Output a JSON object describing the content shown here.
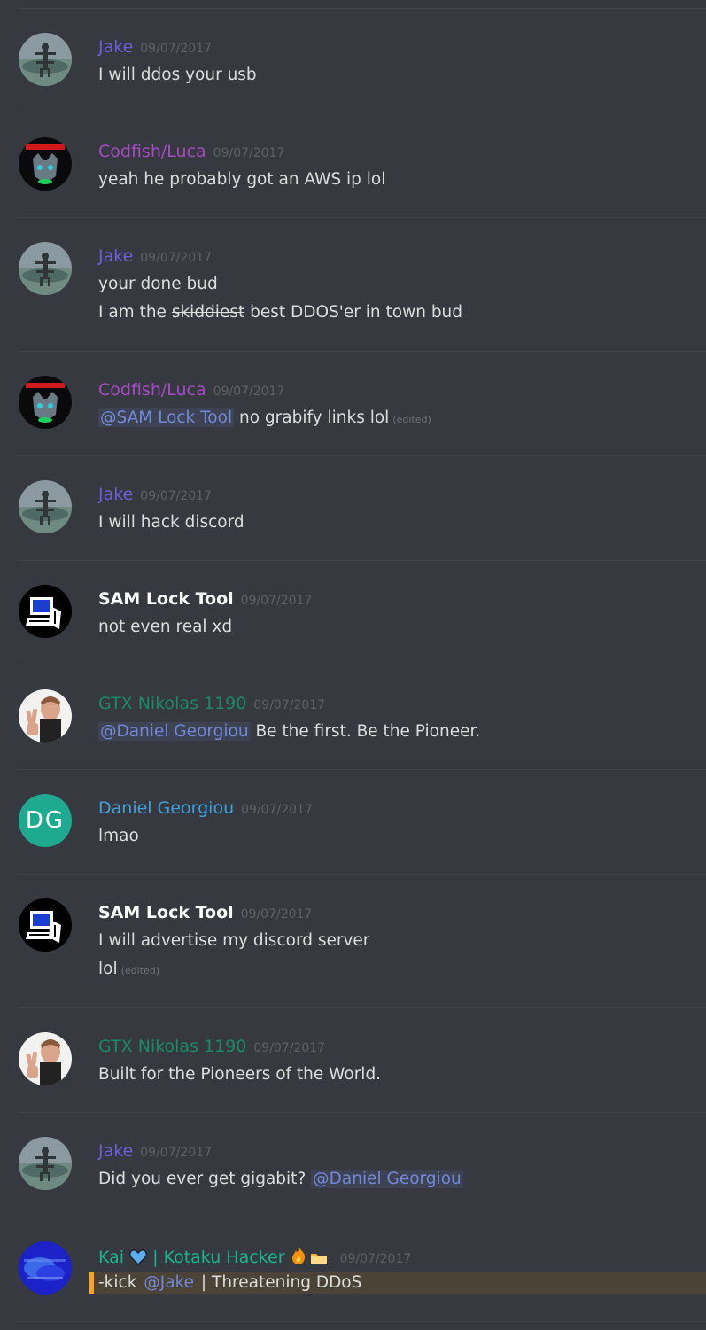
{
  "colors": {
    "background": "#36393f",
    "divider": "#40434a",
    "mention": "#7289da",
    "jake": "#6b5fd8",
    "codfish": "#a54cc4",
    "sam": "#ffffff",
    "gtx": "#1a8a68",
    "daniel": "#3ea1db",
    "kai": "#1ab48f",
    "timestamp": "#5e6167",
    "kick_highlight": "#faa61a"
  },
  "messages": [
    {
      "author": "Jake",
      "timestamp": "09/07/2017",
      "text": "I will ddos your usb"
    },
    {
      "author": "Codfish/Luca",
      "timestamp": "09/07/2017",
      "text": "yeah he probably got an AWS ip lol"
    },
    {
      "author": "Jake",
      "timestamp": "09/07/2017",
      "line1": "your done bud",
      "line2_pre": "I am the ",
      "line2_strike": "skiddiest",
      "line2_post": " best DDOS'er in town bud"
    },
    {
      "author": "Codfish/Luca",
      "timestamp": "09/07/2017",
      "mention": "@SAM Lock Tool",
      "text": " no grabify links lol",
      "edited": "(edited)"
    },
    {
      "author": "Jake",
      "timestamp": "09/07/2017",
      "text": "I will hack discord"
    },
    {
      "author": "SAM Lock Tool",
      "timestamp": "09/07/2017",
      "text": "not even real xd"
    },
    {
      "author": "GTX Nikolas 1190",
      "timestamp": "09/07/2017",
      "mention": "@Daniel Georgiou",
      "text": " Be the first. Be the Pioneer."
    },
    {
      "author": "Daniel Georgiou",
      "avatar_initials": "DG",
      "timestamp": "09/07/2017",
      "text": "lmao"
    },
    {
      "author": "SAM Lock Tool",
      "timestamp": "09/07/2017",
      "line1": "I will advertise my discord server",
      "line2": "lol",
      "edited": "(edited)"
    },
    {
      "author": "GTX Nikolas 1190",
      "timestamp": "09/07/2017",
      "text": "Built for the Pioneers of the World."
    },
    {
      "author": "Jake",
      "timestamp": "09/07/2017",
      "text": "Did you ever get gigabit? ",
      "mention": "@Daniel Georgiou"
    },
    {
      "author_pre": "Kai ",
      "author_post": " | Kotaku Hacker ",
      "timestamp": "09/07/2017",
      "text_pre": "-kick ",
      "mention": "@Jake",
      "text_post": " | Threatening DDoS",
      "icons": [
        "blue-heart-icon",
        "fire-icon",
        "folder-icon"
      ]
    }
  ]
}
